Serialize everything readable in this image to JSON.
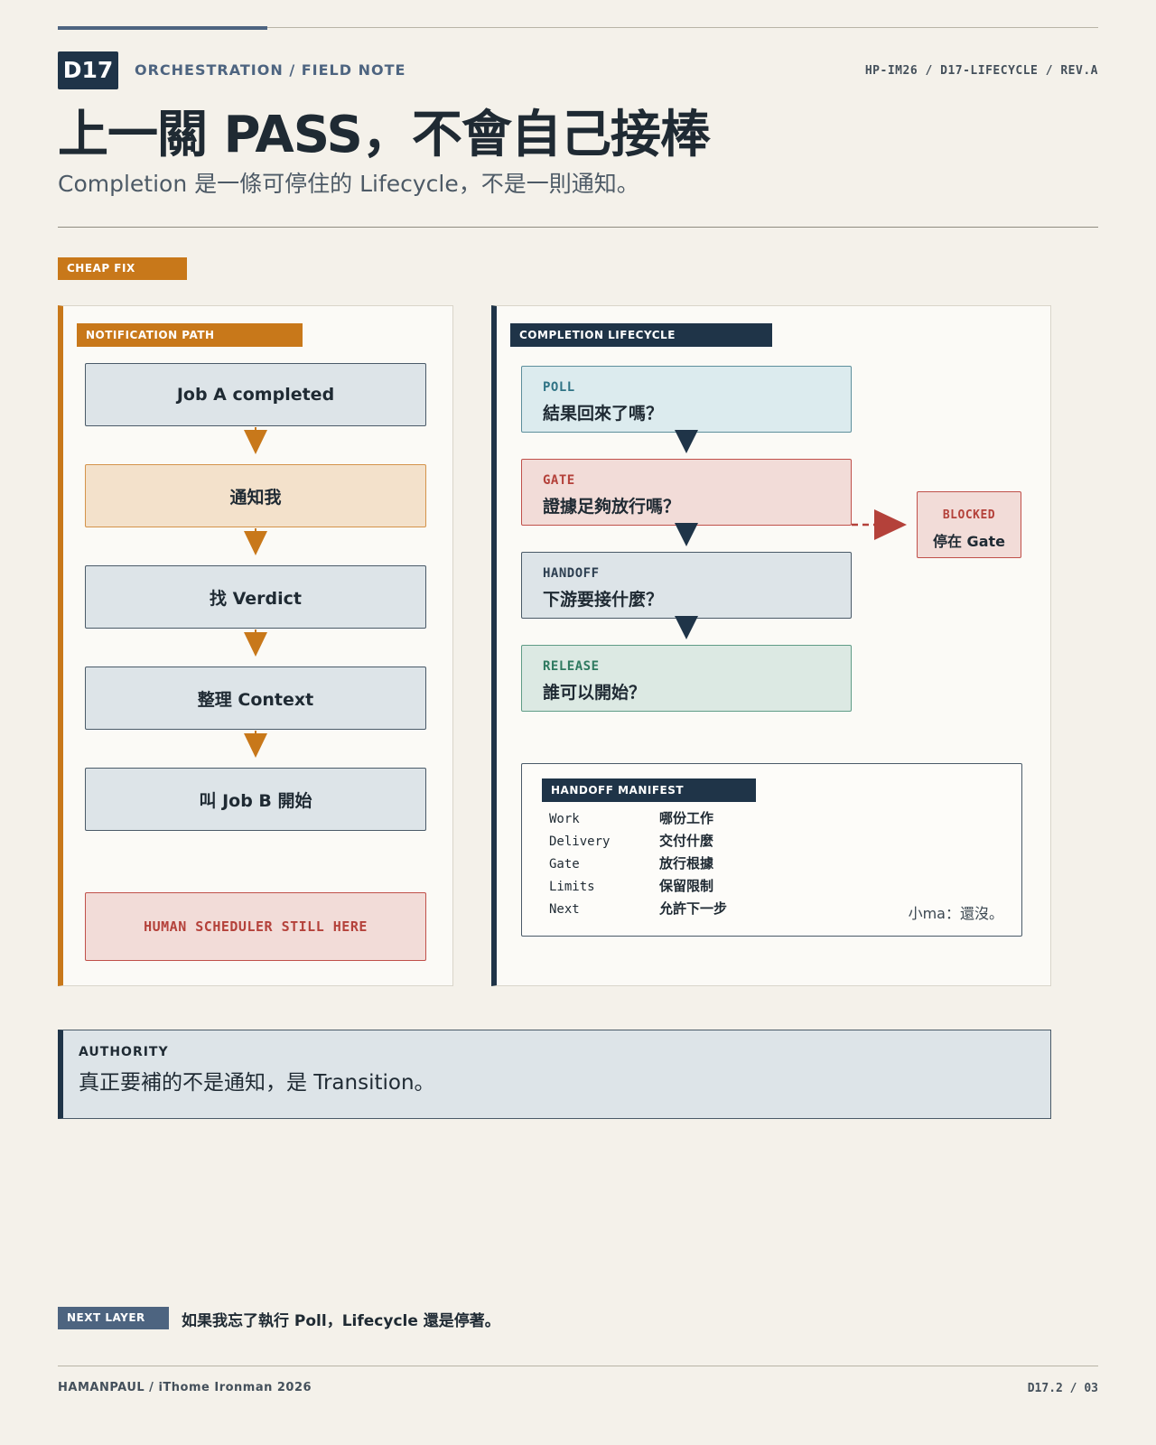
{
  "header": {
    "badge": "D17",
    "kicker": "ORCHESTRATION / FIELD NOTE",
    "ref": "HP-IM26 / D17-LIFECYCLE / REV.A",
    "title": "上一關 PASS，不會自己接棒",
    "subtitle": "Completion 是一條可停住的 Lifecycle，不是一則通知。"
  },
  "cheap_fix_tag": "CHEAP FIX",
  "notification_path": {
    "label": "NOTIFICATION PATH",
    "steps": [
      "Job A completed",
      "通知我",
      "找 Verdict",
      "整理 Context",
      "叫 Job B 開始"
    ],
    "warning": "HUMAN SCHEDULER STILL HERE"
  },
  "completion_lifecycle": {
    "label": "COMPLETION LIFECYCLE",
    "stages": [
      {
        "key": "POLL",
        "question": "結果回來了嗎？"
      },
      {
        "key": "GATE",
        "question": "證據足夠放行嗎？"
      },
      {
        "key": "HANDOFF",
        "question": "下游要接什麼？"
      },
      {
        "key": "RELEASE",
        "question": "誰可以開始？"
      }
    ],
    "blocked": {
      "key": "BLOCKED",
      "value": "停在 Gate"
    }
  },
  "manifest": {
    "label": "HANDOFF MANIFEST",
    "rows": [
      {
        "key": "Work",
        "value": "哪份工作"
      },
      {
        "key": "Delivery",
        "value": "交付什麼"
      },
      {
        "key": "Gate",
        "value": "放行根據"
      },
      {
        "key": "Limits",
        "value": "保留限制"
      },
      {
        "key": "Next",
        "value": "允許下一步"
      }
    ],
    "note": "小ma：還沒。"
  },
  "authority": {
    "label": "AUTHORITY",
    "text": "真正要補的不是通知，是 Transition。"
  },
  "next_layer": {
    "label": "NEXT LAYER",
    "text": "如果我忘了執行 Poll，Lifecycle 還是停著。"
  },
  "footer": {
    "left": "HAMANPAUL / iThome Ironman 2026",
    "right": "D17.2 / 03"
  },
  "colors": {
    "accent_orange": "#c8781a",
    "navy": "#1f3448",
    "blocked_red": "#b4413a"
  }
}
